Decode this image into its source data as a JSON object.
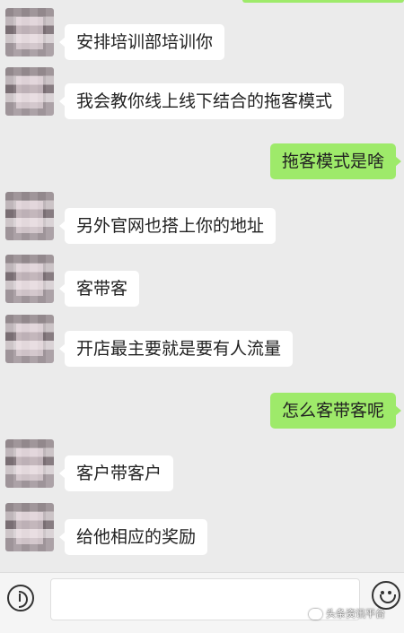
{
  "messages": [
    {
      "side": "left",
      "text": "安排培训部培训你"
    },
    {
      "side": "left",
      "text": "我会教你线上线下结合的拖客模式"
    },
    {
      "side": "right",
      "text": "拖客模式是啥"
    },
    {
      "side": "left",
      "text": "另外官网也搭上你的地址"
    },
    {
      "side": "left",
      "text": "客带客"
    },
    {
      "side": "left",
      "text": "开店最主要就是要有人流量"
    },
    {
      "side": "right",
      "text": "怎么客带客呢"
    },
    {
      "side": "left",
      "text": "客户带客户"
    },
    {
      "side": "left",
      "text": "给他相应的奖励"
    }
  ],
  "input_bar": {
    "voice_icon": "voice-icon",
    "emoji_icon": "emoji-icon",
    "text_value": ""
  },
  "watermark": {
    "text": "头条资讯平台"
  },
  "colors": {
    "sent_bubble": "#9eea6a",
    "received_bubble": "#ffffff",
    "background": "#ebebeb"
  }
}
